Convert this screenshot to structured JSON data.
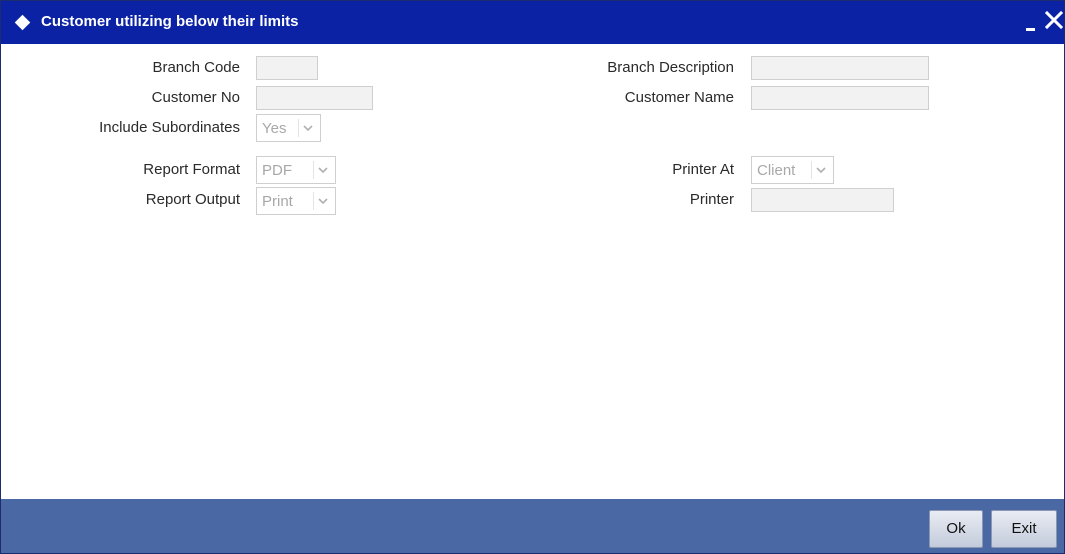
{
  "window": {
    "title": "Customer utilizing below their limits"
  },
  "form": {
    "branch_code": {
      "label": "Branch Code",
      "value": ""
    },
    "branch_description": {
      "label": "Branch Description",
      "value": ""
    },
    "customer_no": {
      "label": "Customer No",
      "value": ""
    },
    "customer_name": {
      "label": "Customer Name",
      "value": ""
    },
    "include_subordinates": {
      "label": "Include Subordinates",
      "selected": "Yes"
    },
    "report_format": {
      "label": "Report Format",
      "selected": "PDF"
    },
    "printer_at": {
      "label": "Printer At",
      "selected": "Client"
    },
    "report_output": {
      "label": "Report Output",
      "selected": "Print"
    },
    "printer": {
      "label": "Printer",
      "value": ""
    }
  },
  "footer": {
    "ok_label": "Ok",
    "exit_label": "Exit"
  },
  "colors": {
    "titlebar": "#0a22a3",
    "footer": "#4a68a4"
  }
}
